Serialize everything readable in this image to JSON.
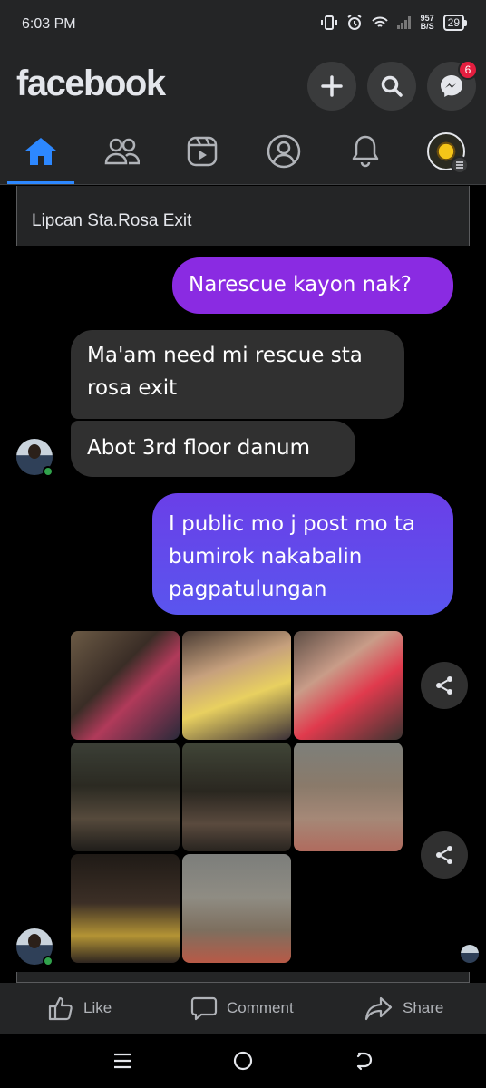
{
  "status_bar": {
    "time": "6:03 PM",
    "net_speed_value": "957",
    "net_speed_unit": "B/S",
    "battery": "29"
  },
  "header": {
    "logo": "facebook",
    "messenger_badge": "6"
  },
  "post": {
    "text": "Lipcan Sta.Rosa Exit"
  },
  "chat": {
    "messages": [
      {
        "direction": "outgoing",
        "text": "Narescue kayon nak?"
      },
      {
        "direction": "incoming",
        "text": "Ma'am need mi rescue sta rosa exit"
      },
      {
        "direction": "incoming",
        "text": "Abot 3rd floor danum"
      },
      {
        "direction": "outgoing",
        "text": "I public mo j post mo ta bumirok nakabalin pagpatulungan"
      }
    ],
    "photo_count": 8
  },
  "actions": {
    "like": "Like",
    "comment": "Comment",
    "share": "Share"
  },
  "colors": {
    "accent": "#2d88ff",
    "outgoing_bubble": "#8a2be2",
    "incoming_bubble": "#303030",
    "badge": "#e41e3f"
  }
}
